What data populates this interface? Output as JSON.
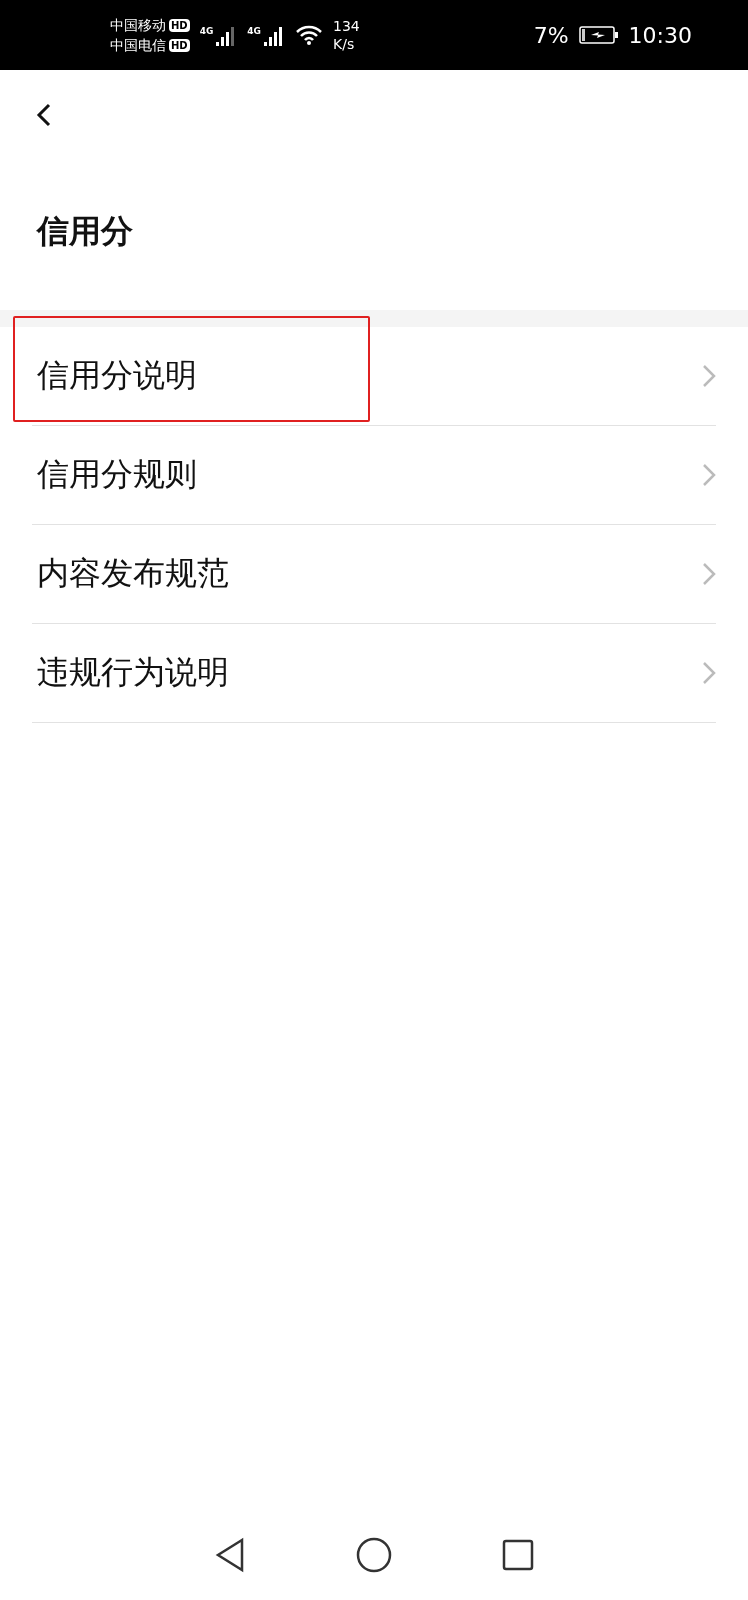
{
  "status_bar": {
    "carriers": [
      {
        "name": "中国移动",
        "badge": "HD",
        "network": "4G"
      },
      {
        "name": "中国电信",
        "badge": "HD",
        "network": "4G"
      }
    ],
    "speed_value": "134",
    "speed_unit": "K/s",
    "battery": "7%",
    "time": "10:30"
  },
  "page": {
    "title": "信用分"
  },
  "items": [
    {
      "label": "信用分说明",
      "highlighted": true
    },
    {
      "label": "信用分规则",
      "highlighted": false
    },
    {
      "label": "内容发布规范",
      "highlighted": false
    },
    {
      "label": "违规行为说明",
      "highlighted": false
    }
  ]
}
